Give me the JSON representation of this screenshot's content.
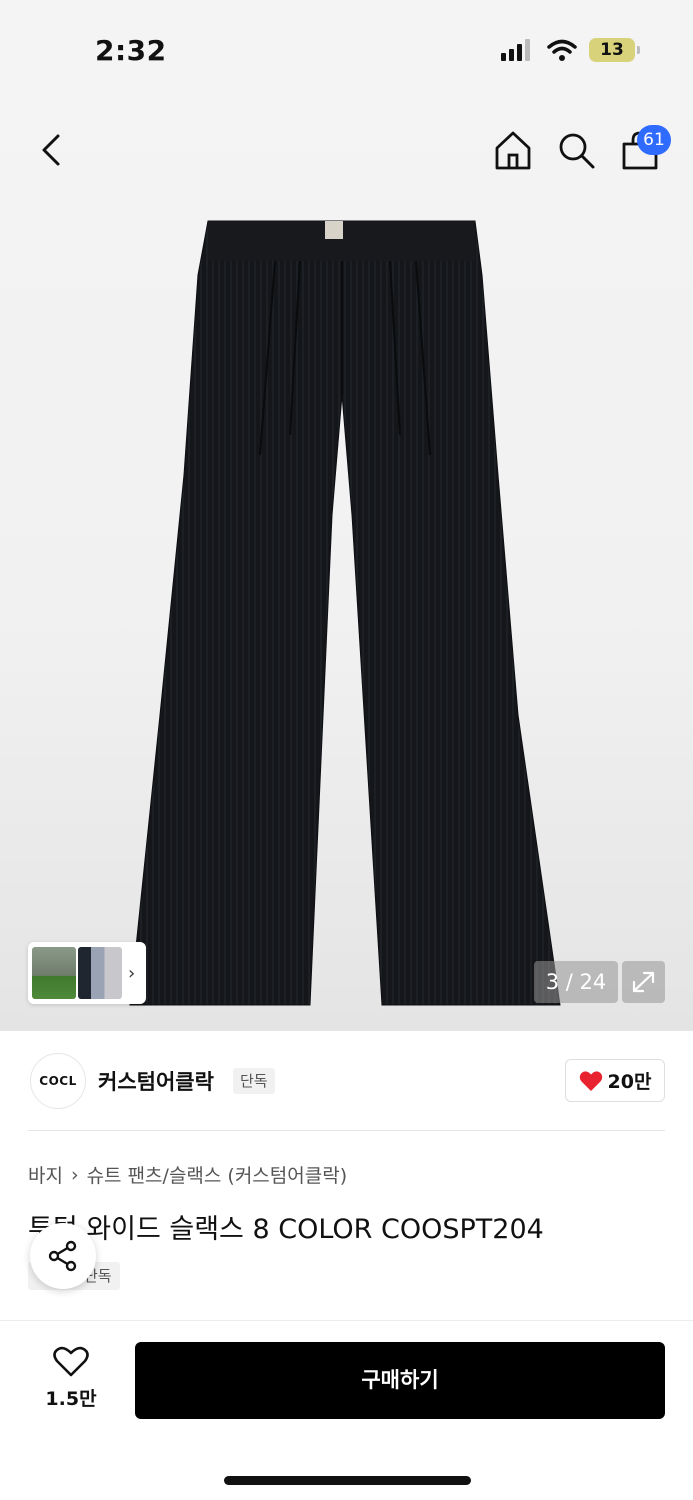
{
  "status_bar": {
    "time": "2:32",
    "battery": "13"
  },
  "nav": {
    "cart_count": "61"
  },
  "gallery": {
    "counter": "3 / 24"
  },
  "brand": {
    "logo_text": "COCL",
    "name": "커스텀어클락",
    "tag": "단독",
    "like_count": "20만"
  },
  "breadcrumb": {
    "items": [
      "바지",
      "슈트 팬츠/슬랙스 (커스텀어클락)"
    ]
  },
  "product": {
    "title": "투턱 와이드 슬랙스 8 COLOR COOSPT204",
    "tag": "단독"
  },
  "bottom": {
    "wish_count": "1.5만",
    "buy_label": "구매하기"
  },
  "colors": {
    "badge": "#2f6bff",
    "heart": "#e8232f",
    "buy_button": "#000000"
  }
}
